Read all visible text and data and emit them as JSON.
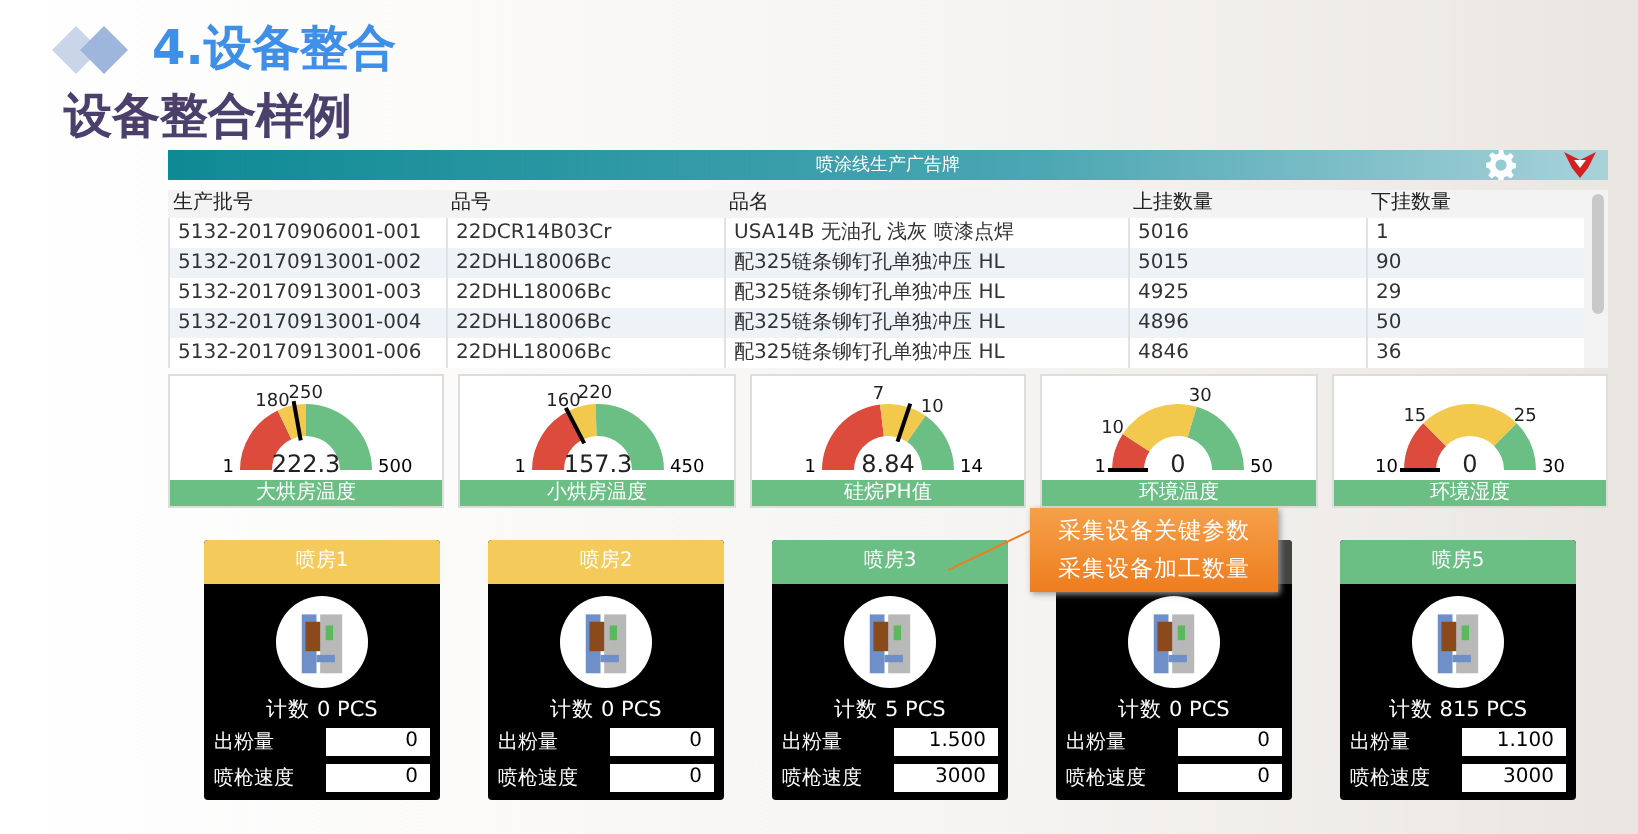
{
  "header": {
    "section_title": "4.设备整合",
    "subtitle": "设备整合样例"
  },
  "board": {
    "title": "喷涂线生产广告牌",
    "table": {
      "columns": [
        "生产批号",
        "品号",
        "品名",
        "上挂数量",
        "下挂数量"
      ],
      "rows": [
        [
          "5132-20170906001-001",
          "22DCR14B03Cr",
          "USA14B 无油孔 浅灰 喷漆点焊",
          "5016",
          "1"
        ],
        [
          "5132-20170913001-002",
          "22DHL18006Bc",
          "配325链条铆钉孔单独冲压 HL",
          "5015",
          "90"
        ],
        [
          "5132-20170913001-003",
          "22DHL18006Bc",
          "配325链条铆钉孔单独冲压 HL",
          "4925",
          "29"
        ],
        [
          "5132-20170913001-004",
          "22DHL18006Bc",
          "配325链条铆钉孔单独冲压 HL",
          "4896",
          "50"
        ],
        [
          "5132-20170913001-006",
          "22DHL18006Bc",
          "配325链条铆钉孔单独冲压 HL",
          "4846",
          "36"
        ]
      ]
    },
    "gauges": [
      {
        "label": "大烘房温度",
        "value": "222.3",
        "min_label": "1",
        "max_label": "500",
        "zones": [
          {
            "color": "#dc4b3c",
            "end_label": "180"
          },
          {
            "color": "#f2c94c",
            "end_label": "250"
          },
          {
            "color": "#6bbf85"
          }
        ]
      },
      {
        "label": "小烘房温度",
        "value": "157.3",
        "min_label": "1",
        "max_label": "450",
        "zones": [
          {
            "color": "#dc4b3c",
            "end_label": "160"
          },
          {
            "color": "#f2c94c",
            "end_label": "220"
          },
          {
            "color": "#6bbf85"
          }
        ]
      },
      {
        "label": "硅烷PH值",
        "value": "8.84",
        "min_label": "1",
        "max_label": "14",
        "zones": [
          {
            "color": "#dc4b3c",
            "end_label": "7"
          },
          {
            "color": "#f2c94c",
            "end_label": "10"
          },
          {
            "color": "#6bbf85"
          }
        ]
      },
      {
        "label": "环境温度",
        "value": "0",
        "min_label": "1",
        "max_label": "50",
        "zones": [
          {
            "color": "#dc4b3c",
            "end_label": "10"
          },
          {
            "color": "#f2c94c",
            "end_label": "30"
          },
          {
            "color": "#6bbf85"
          }
        ]
      },
      {
        "label": "环境湿度",
        "value": "0",
        "min_label": "10",
        "max_label": "30",
        "zones": [
          {
            "color": "#dc4b3c",
            "end_label": "15"
          },
          {
            "color": "#f2c94c",
            "end_label": "25"
          },
          {
            "color": "#6bbf85"
          }
        ]
      }
    ],
    "rooms": [
      {
        "title": "喷房1",
        "color": "#f4cb5a",
        "count": "计数 0 PCS",
        "fields": [
          {
            "label": "出粉量",
            "value": "0"
          },
          {
            "label": "喷枪速度",
            "value": "0"
          }
        ]
      },
      {
        "title": "喷房2",
        "color": "#f4cb5a",
        "count": "计数 0 PCS",
        "fields": [
          {
            "label": "出粉量",
            "value": "0"
          },
          {
            "label": "喷枪速度",
            "value": "0"
          }
        ]
      },
      {
        "title": "喷房3",
        "color": "#6bbf85",
        "count": "计数 5 PCS",
        "fields": [
          {
            "label": "出粉量",
            "value": "1.500"
          },
          {
            "label": "喷枪速度",
            "value": "3000"
          }
        ]
      },
      {
        "count": "计数 0 PCS",
        "fields": [
          {
            "label": "出粉量",
            "value": "0"
          },
          {
            "label": "喷枪速度",
            "value": "0"
          }
        ]
      },
      {
        "title": "喷房5",
        "color": "#6bbf85",
        "count": "计数 815 PCS",
        "fields": [
          {
            "label": "出粉量",
            "value": "1.100"
          },
          {
            "label": "喷枪速度",
            "value": "3000"
          }
        ]
      }
    ],
    "callout": {
      "lines": [
        "采集设备关键参数",
        "采集设备加工数量"
      ]
    }
  }
}
